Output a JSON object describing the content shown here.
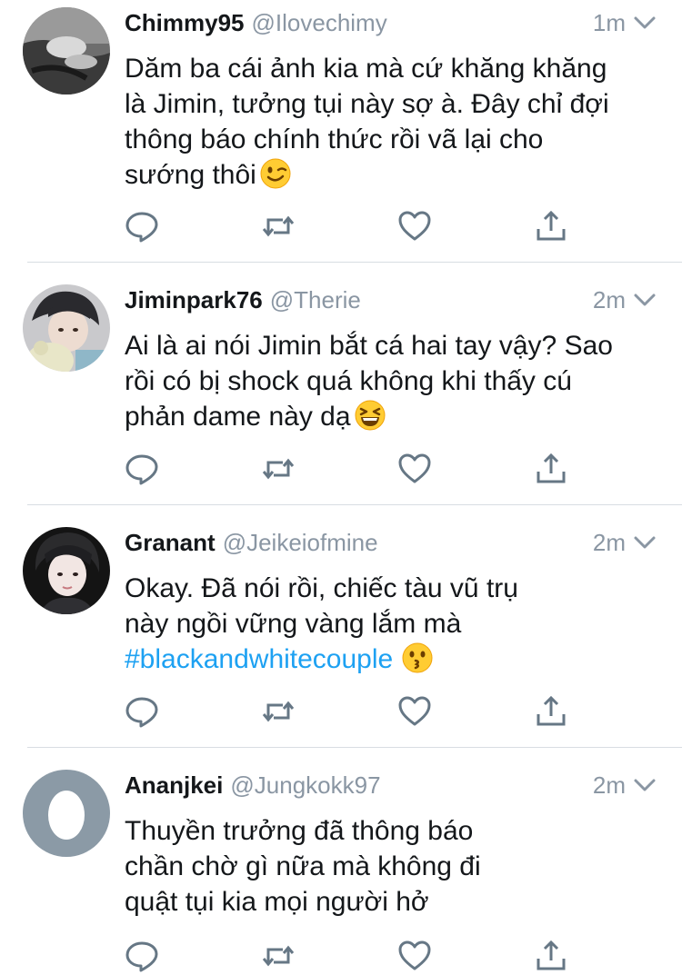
{
  "tweets": [
    {
      "name": "Chimmy95",
      "handle": "@Ilovechimy",
      "time": "1m",
      "lines": [
        "Dăm ba cái ảnh kia mà cứ khăng khăng",
        "là Jimin, tưởng tụi này sợ à. Đây chỉ đợi",
        "thông báo chính thức rồi vã lại cho",
        "sướng thôi"
      ],
      "emoji": "winking-face"
    },
    {
      "name": "Jiminpark76",
      "handle": "@Therie",
      "time": "2m",
      "lines": [
        "Ai là ai nói Jimin bắt cá hai tay vậy? Sao",
        "rồi có bị shock quá không khi thấy cú",
        "phản dame này dạ"
      ],
      "emoji": "grinning-squinting-face"
    },
    {
      "name": "Granant",
      "handle": "@Jeikeiofmine",
      "time": "2m",
      "lines": [
        "Okay. Đã nói rồi, chiếc tàu vũ trụ",
        "này ngồi vững vàng lắm mà"
      ],
      "hashtag": "#blackandwhitecouple",
      "emoji": "kissing-face"
    },
    {
      "name": "Ananjkei",
      "handle": "@Jungkokk97",
      "time": "2m",
      "lines": [
        "Thuyền trưởng đã thông báo",
        "chần chờ gì nữa mà không đi",
        "quật tụi kia mọi người hở"
      ]
    }
  ],
  "colors": {
    "text": "#14171a",
    "secondary": "#8a96a3",
    "link": "#1da1f2",
    "divider": "#d8dde2",
    "icon": "#667785"
  }
}
